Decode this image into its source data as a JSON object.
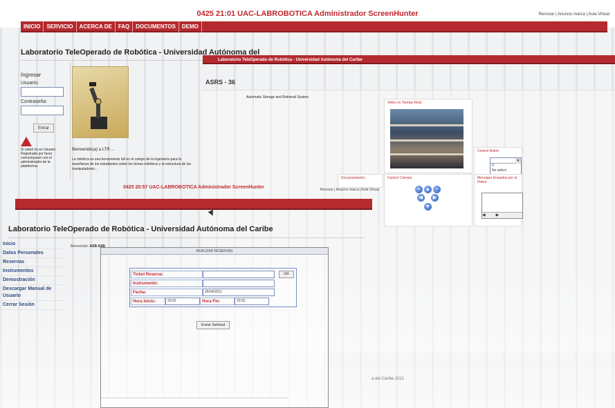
{
  "window_back": {
    "title": "0425 21:01 UAC-LABROBOTICA Administrador ScreenHunter",
    "top_links": "Renovar | Anuncio marca | Aula Virtual",
    "nav": [
      "INICIO",
      "SERVICIO",
      "ACERCA DE",
      "FAQ",
      "DOCUMENTOS",
      "DEMO"
    ],
    "lab_title": "Laboratorio TeleOperado de Robótica - Universidad Autónoma del",
    "login": {
      "heading": "Ingresar",
      "user_label": "Usuario:",
      "pass_label": "Contraseña:",
      "button": "Entrar"
    },
    "warning_text": "Si usted no es Usuario Registrado por favor comuníquese con el administrador de la plataforma.",
    "welcome": "Bienvenido(a) a LTR ...",
    "welcome_body": "La robótica es una herramienta útil en el campo de la ingeniería para la enseñanza de los estudiantes sobre los temas robóticos y la estructura de los manipuladores..."
  },
  "window_middle": {
    "bar": "Laboratorio TeleOperado de Robótica - Universidad Autónoma del Caribe",
    "heading": "ASRS - 36",
    "subtitle": "Automatic Storage and Retrieval System",
    "panels": {
      "video": "Video en Tiempo Real",
      "control": "Control Robot",
      "documentation": "Documentación",
      "camera": "Control Cámara",
      "messages": "Mensajes Enviados por el Robot"
    },
    "select_options": [
      "0",
      "No select"
    ],
    "footer": "a del Caribe 2011"
  },
  "window_front": {
    "title": "0425 20:57 UAC-LABROBOTICA Administrador ScreenHunter",
    "top_links": "Renovar | Anuncio marca | Aula Virtual",
    "lab_title": "Laboratorio TeleOperado de Robótica - Universidad Autónoma del Caribe",
    "menu": [
      "Inicio",
      "Datos Personales",
      "Reservas",
      "Instrumentos",
      "Demostración",
      "Descargar Manual de Usuario",
      "Cerrar Sesión"
    ],
    "welcome_prefix": "Bienvenido:",
    "welcome_user": "ASB ASB",
    "form": {
      "header": "REALIZAR RESERVAS",
      "ticket_label": "Ticket Reserva:",
      "ticket_btn": "GR",
      "instrument_label": "Instrumento:",
      "date_label": "Fecha:",
      "date_value": "25/04/2011",
      "start_label": "Hora Inicio:",
      "start_value": "20:52",
      "end_label": "Hora Fin:",
      "end_value": "20:52",
      "submit": "Enviar Solicitud"
    }
  },
  "colors": {
    "brand_red": "#b42a2e",
    "title_red": "#c0282e",
    "menu_blue": "#2d4a7e"
  }
}
